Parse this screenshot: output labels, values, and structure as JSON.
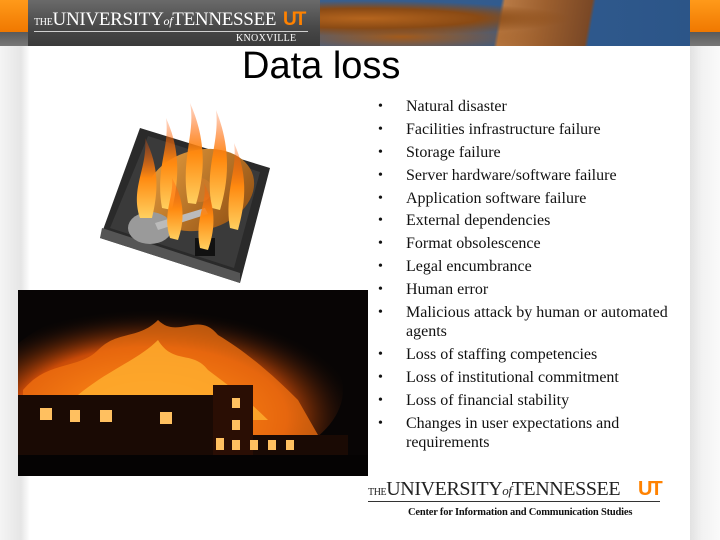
{
  "header": {
    "university_prefix": "THE",
    "university_name_1": "UNIVERSITY",
    "university_of": "of",
    "university_name_2": "TENNESSEE",
    "campus": "KNOXVILLE",
    "logo_text": "UT"
  },
  "slide": {
    "title": "Data loss",
    "bullets": [
      "Natural disaster",
      "Facilities infrastructure failure",
      "Storage failure",
      "Server hardware/software failure",
      "Application software failure",
      "External dependencies",
      "Format obsolescence",
      "Legal encumbrance",
      "Human error",
      "Malicious attack by human or automated agents",
      "Loss of staffing competencies",
      "Loss of institutional commitment",
      "Loss of financial stability",
      "Changes in user expectations and requirements"
    ],
    "bullet_glyph": "•",
    "images": {
      "hard_drive": "burning-hard-drive-image",
      "building": "burning-building-image"
    }
  },
  "footer": {
    "university_prefix": "THE",
    "university_name_1": "UNIVERSITY",
    "university_of": "of",
    "university_name_2": "TENNESSEE",
    "logo_text": "UT",
    "center_name": "Center for Information and Communication Studies"
  },
  "colors": {
    "ut_orange": "#ff8200",
    "banner_gray": "#484848",
    "sky_blue": "#2f5a8e"
  }
}
